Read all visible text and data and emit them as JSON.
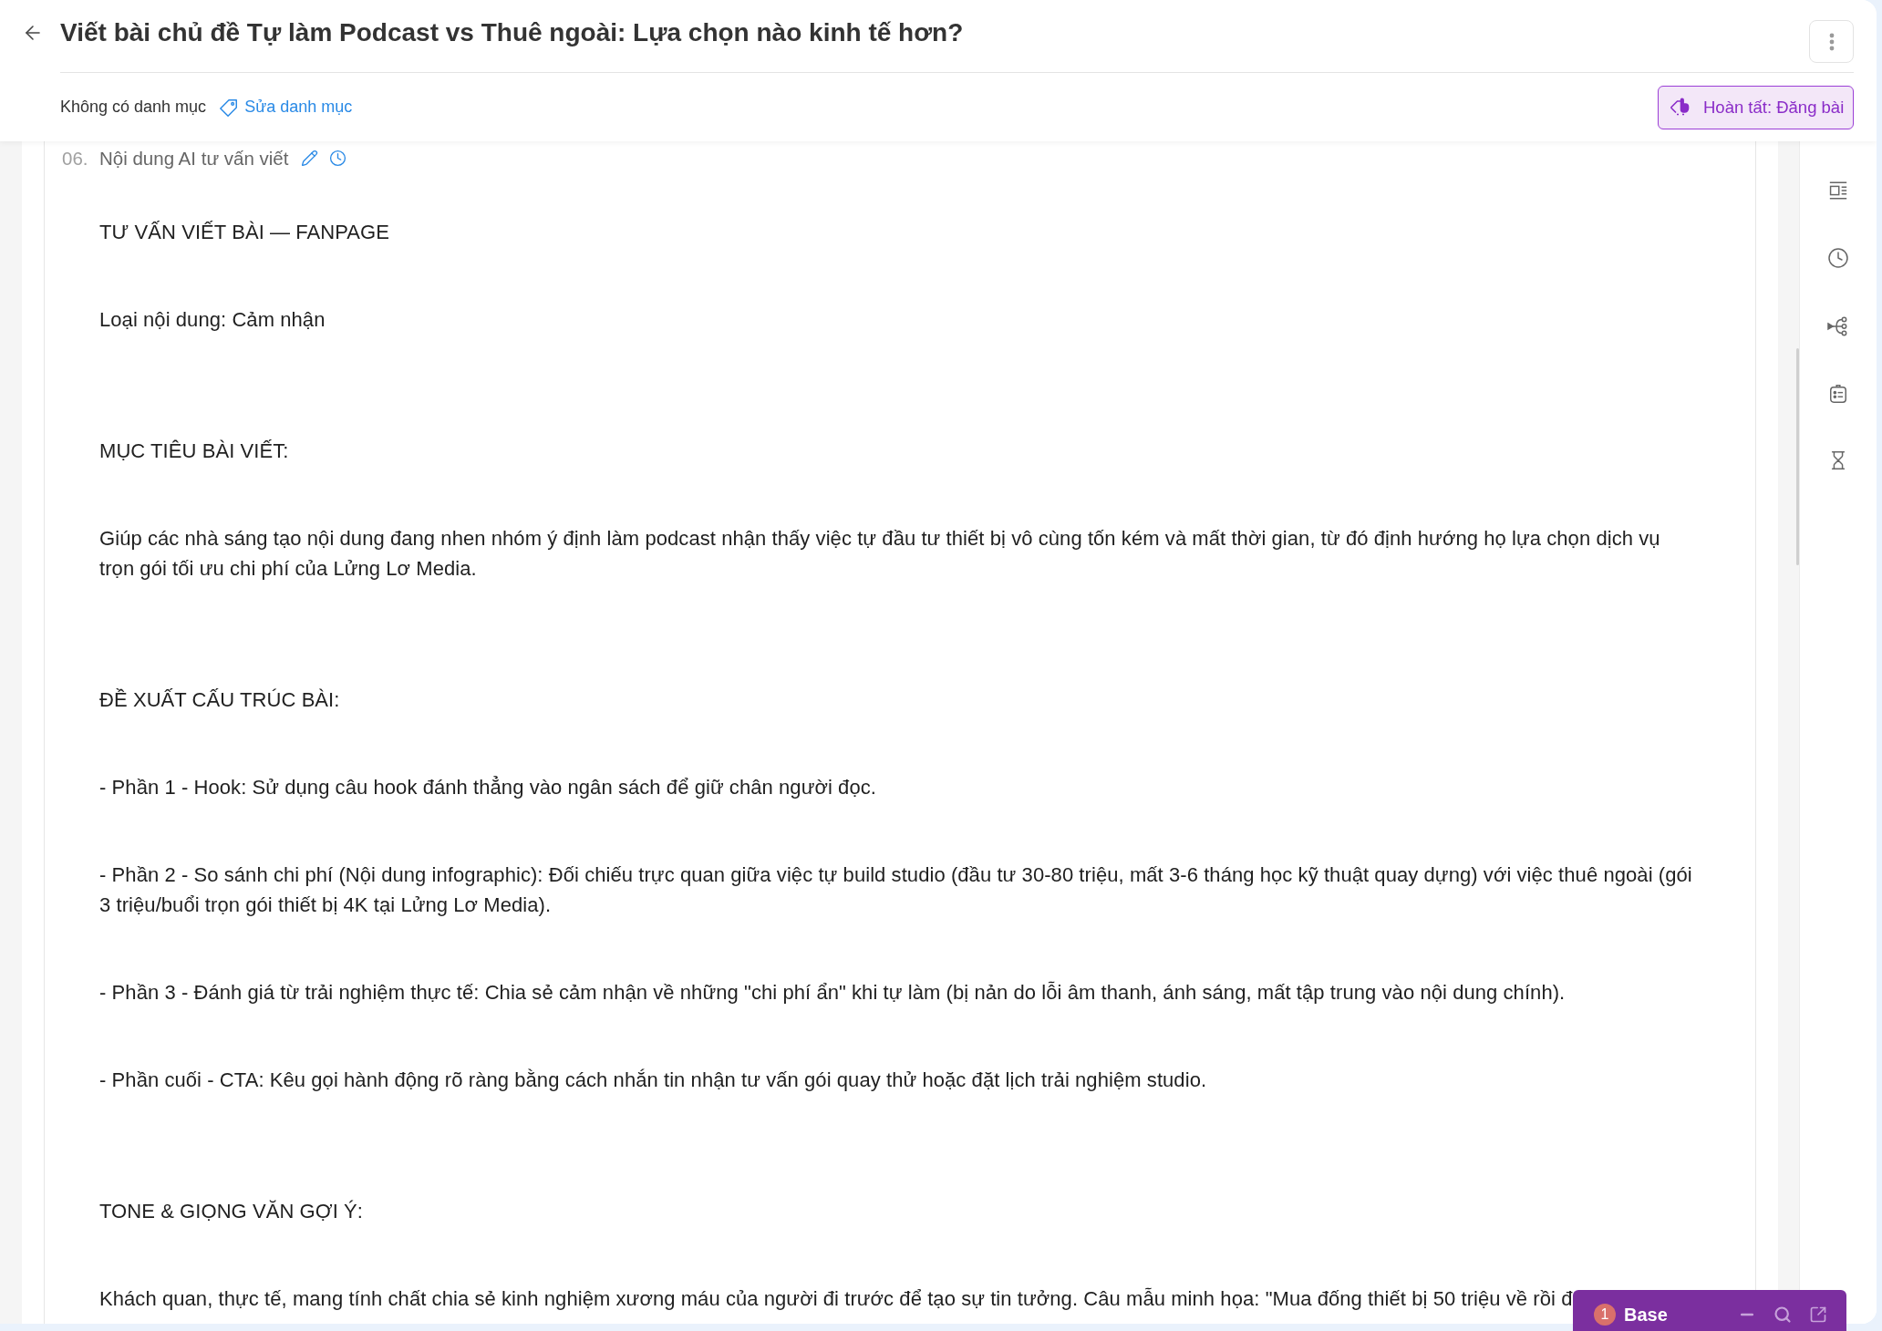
{
  "header": {
    "title": "Viết bài chủ đề Tự làm Podcast vs Thuê ngoài: Lựa chọn nào kinh tế hơn?",
    "category": "Không có danh mục",
    "edit_category_link": "Sửa danh mục",
    "publish_button": "Hoàn tất: Đăng bài"
  },
  "section": {
    "number": "06.",
    "title": "Nội dung AI tư vấn viết",
    "blocks": [
      {
        "kind": "heading",
        "lines": [
          "TƯ VẤN VIẾT BÀI — FANPAGE"
        ]
      },
      {
        "kind": "text",
        "lines": [
          "Loại nội dung: Cảm nhận"
        ]
      },
      {
        "kind": "heading",
        "lines": [
          "MỤC TIÊU BÀI VIẾT:"
        ]
      },
      {
        "kind": "text",
        "lines": [
          "Giúp các nhà sáng tạo nội dung đang nhen nhóm ý định làm podcast nhận thấy việc tự đầu tư thiết bị vô cùng tốn kém và mất thời gian, từ đó định hướng họ lựa chọn dịch vụ",
          "trọn gói tối ưu chi phí của Lửng Lơ Media."
        ]
      },
      {
        "kind": "heading",
        "lines": [
          "ĐỀ XUẤT CẤU TRÚC BÀI:"
        ]
      },
      {
        "kind": "text",
        "lines": [
          "- Phần 1 - Hook: Sử dụng câu hook đánh thẳng vào ngân sách để giữ chân người đọc."
        ]
      },
      {
        "kind": "text",
        "lines": [
          "- Phần 2 - So sánh chi phí (Nội dung infographic): Đối chiếu trực quan giữa việc tự build studio (đầu tư 30-80 triệu, mất 3-6 tháng học kỹ thuật quay dựng) với việc thuê ngoài (gói",
          "3 triệu/buổi trọn gói thiết bị 4K tại Lửng Lơ Media)."
        ]
      },
      {
        "kind": "text",
        "lines": [
          "- Phần 3 - Đánh giá từ trải nghiệm thực tế: Chia sẻ cảm nhận về những \"chi phí ẩn\" khi tự làm (bị nản do lỗi âm thanh, ánh sáng, mất tập trung vào nội dung chính)."
        ]
      },
      {
        "kind": "text",
        "lines": [
          "- Phần cuối - CTA: Kêu gọi hành động rõ ràng bằng cách nhắn tin nhận tư vấn gói quay thử hoặc đặt lịch trải nghiệm studio."
        ]
      },
      {
        "kind": "heading",
        "lines": [
          "TONE & GIỌNG VĂN GỢI Ý:"
        ]
      },
      {
        "kind": "text",
        "lines": [
          "Khách quan, thực tế, mang tính chất chia sẻ kinh nghiệm xương máu của người đi trước để tạo sự tin tưởng. Câu mẫu minh họa: \"Mua đống thiết bị 50 triệu về rồi đ"
        ]
      }
    ]
  },
  "chat_widget": {
    "badge": "1",
    "title": "Base"
  }
}
